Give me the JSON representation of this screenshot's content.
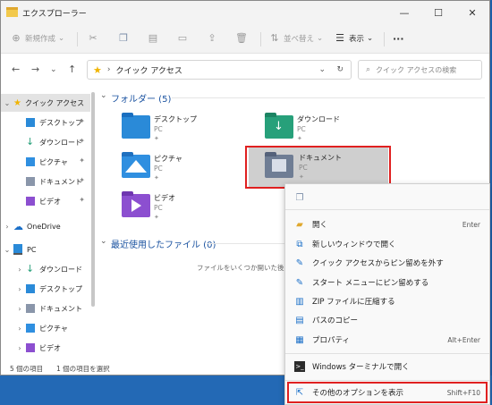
{
  "window": {
    "title": "エクスプローラー",
    "minimize": "—",
    "maximize": "☐",
    "close": "✕"
  },
  "toolbar": {
    "new_label": "新規作成",
    "sort_label": "並べ替え",
    "view_label": "表示",
    "more": "···"
  },
  "address": {
    "path": "クイック アクセス",
    "search_placeholder": "クイック アクセスの検索"
  },
  "sidebar": {
    "quick_access": "クイック アクセス",
    "items": [
      {
        "label": "デスクトップ"
      },
      {
        "label": "ダウンロード"
      },
      {
        "label": "ピクチャ"
      },
      {
        "label": "ドキュメント"
      },
      {
        "label": "ビデオ"
      }
    ],
    "onedrive": "OneDrive",
    "pc": "PC",
    "pc_items": [
      {
        "label": "ダウンロード"
      },
      {
        "label": "デスクトップ"
      },
      {
        "label": "ドキュメント"
      },
      {
        "label": "ピクチャ"
      },
      {
        "label": "ビデオ"
      }
    ]
  },
  "main": {
    "folders_header": "フォルダー (5)",
    "recent_header": "最近使用したファイル (0)",
    "recent_empty": "ファイルをいくつか開いた後、ここ",
    "folders": [
      {
        "name": "デスクトップ",
        "location": "PC",
        "color": "#2a8ad8"
      },
      {
        "name": "ダウンロード",
        "location": "PC",
        "color": "#27a07a"
      },
      {
        "name": "ピクチャ",
        "location": "PC",
        "color": "#2f8fe0"
      },
      {
        "name": "ドキュメント",
        "location": "PC",
        "color": "#6f7d94"
      },
      {
        "name": "ビデオ",
        "location": "PC",
        "color": "#8c4fd0"
      }
    ]
  },
  "status": {
    "count": "5 個の項目",
    "selected": "1 個の項目を選択"
  },
  "context_menu": {
    "items": [
      {
        "label": "開く",
        "shortcut": "Enter",
        "icon": "folder-open-icon"
      },
      {
        "label": "新しいウィンドウで開く",
        "shortcut": "",
        "icon": "new-window-icon"
      },
      {
        "label": "クイック アクセスからピン留めを外す",
        "shortcut": "",
        "icon": "unpin-icon"
      },
      {
        "label": "スタート メニューにピン留めする",
        "shortcut": "",
        "icon": "pin-start-icon"
      },
      {
        "label": "ZIP ファイルに圧縮する",
        "shortcut": "",
        "icon": "zip-icon"
      },
      {
        "label": "パスのコピー",
        "shortcut": "",
        "icon": "copy-path-icon"
      },
      {
        "label": "プロパティ",
        "shortcut": "Alt+Enter",
        "icon": "properties-icon"
      }
    ],
    "terminal": "Windows ターミナルで開く",
    "more_options": "その他のオプションを表示",
    "more_options_shortcut": "Shift+F10"
  },
  "colors": {
    "highlight_border": "#e02020",
    "accent": "#1a52a0"
  }
}
